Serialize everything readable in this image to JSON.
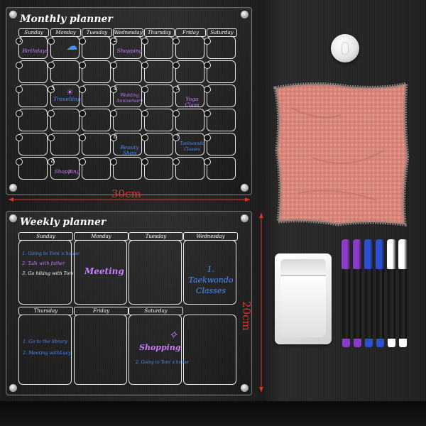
{
  "monthly": {
    "title": "Monthly planner",
    "days": [
      "Sunday",
      "Monday",
      "Tuesday",
      "Wednesday",
      "Thursday",
      "Friday",
      "Saturday"
    ],
    "notes": [
      {
        "num": "1",
        "text": "Birthdays",
        "color": "purple"
      },
      {
        "num": "2",
        "text": "Shopping",
        "color": "purple"
      },
      {
        "num": "3",
        "text": "Travelling",
        "color": "blue"
      },
      {
        "num": "4",
        "text": "Wedding Anniversary",
        "color": "purple"
      },
      {
        "num": "5",
        "text": "Yoga Class",
        "color": "purple"
      },
      {
        "num": "6",
        "text": "Beauty Shop",
        "color": "blue"
      },
      {
        "num": "7",
        "text": "Taekwondo Classes",
        "color": "blue"
      },
      {
        "num": "8",
        "text": "Shopping",
        "color": "purple"
      }
    ]
  },
  "weekly": {
    "title": "Weekly planner",
    "days_top": [
      "Sunday",
      "Monday",
      "Tuesday",
      "Wednesday"
    ],
    "days_bottom": [
      "Thursday",
      "Friday",
      "Saturday"
    ],
    "sunday_notes": [
      "1. Going to Tom' s house",
      "2. Talk with father",
      "3. Go hiking with Tom"
    ],
    "monday_note": "Meeting",
    "wednesday_note": "1. Taekwondo Classes",
    "thursday_notes": [
      "1. Go to the library",
      "2. Meeting withLucy"
    ],
    "saturday_note": "Shopping",
    "saturday_sub": "2. Going to Tom' s house"
  },
  "dimensions": {
    "width": "30cm",
    "height": "20cm"
  },
  "accessories": {
    "markers": [
      "#8a3bc7",
      "#8a3bc7",
      "#2d4fd1",
      "#2d4fd1",
      "#ffffff",
      "#ffffff"
    ],
    "cloth_color": "#d9867a",
    "accent_red": "#e0342c"
  }
}
